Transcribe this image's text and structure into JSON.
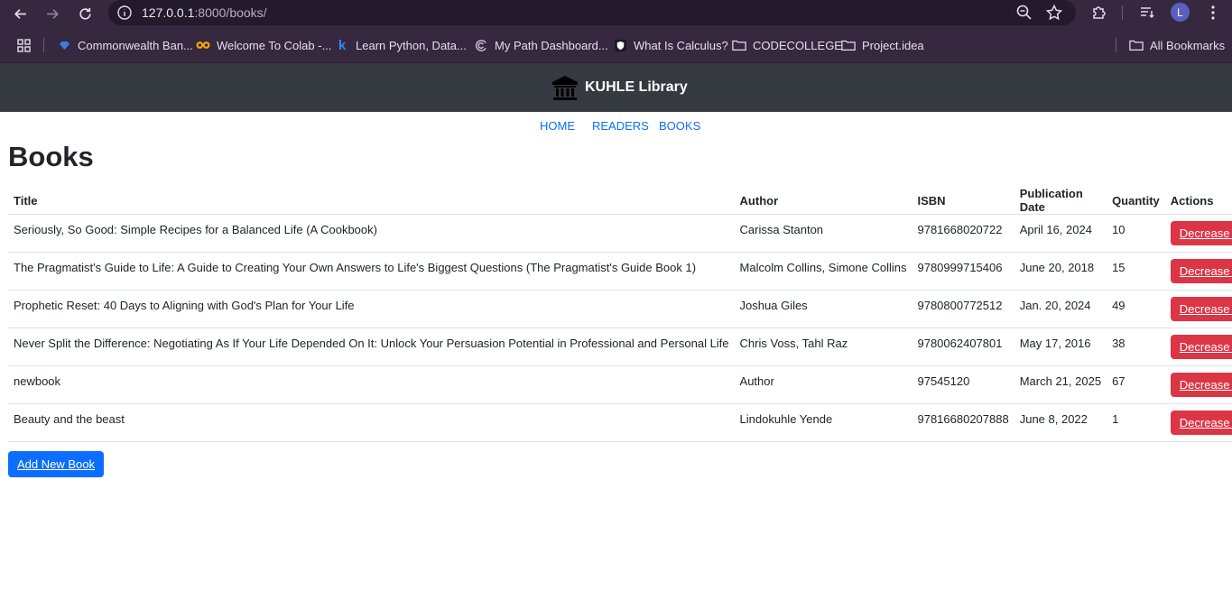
{
  "browser": {
    "url_host": "127.0.0.1",
    "url_rest": ":8000/books/",
    "profile_initial": "L",
    "bookmarks": [
      {
        "label": "Commonwealth Ban...",
        "icon": "diamond-icon",
        "color": "#3b7ae0"
      },
      {
        "label": "Welcome To Colab -...",
        "icon": "colab-icon",
        "color": "#f9ab00"
      },
      {
        "label": "Learn Python, Data...",
        "icon": "k-icon",
        "color": "#2d8cf0"
      },
      {
        "label": "My Path Dashboard...",
        "icon": "swirl-icon",
        "color": "#cfc7d8"
      },
      {
        "label": "What Is Calculus?",
        "icon": "shield-icon",
        "color": "#ffffff"
      },
      {
        "label": "CODECOLLEGE",
        "icon": "folder-icon",
        "color": "#e6dfec"
      },
      {
        "label": "Project.idea",
        "icon": "folder-icon",
        "color": "#e6dfec"
      }
    ],
    "all_bookmarks": "All Bookmarks"
  },
  "site": {
    "brand": "KUHLE Library",
    "nav": [
      "HOME",
      "READERS",
      "BOOKS"
    ]
  },
  "page": {
    "title": "Books",
    "columns": [
      "Title",
      "Author",
      "ISBN",
      "Publication Date",
      "Quantity",
      "Actions"
    ],
    "rows": [
      {
        "title": "Seriously, So Good: Simple Recipes for a Balanced Life (A Cookbook)",
        "author": "Carissa Stanton",
        "isbn": "9781668020722",
        "date": "April 16, 2024",
        "qty": "10",
        "action": "Decrease Quantity"
      },
      {
        "title": "The Pragmatist's Guide to Life: A Guide to Creating Your Own Answers to Life's Biggest Questions (The Pragmatist's Guide Book 1)",
        "author": "Malcolm Collins, Simone Collins",
        "isbn": "9780999715406",
        "date": "June 20, 2018",
        "qty": "15",
        "action": "Decrease Quantity"
      },
      {
        "title": "Prophetic Reset: 40 Days to Aligning with God's Plan for Your Life",
        "author": "Joshua Giles",
        "isbn": "9780800772512",
        "date": "Jan. 20, 2024",
        "qty": "49",
        "action": "Decrease Quantity"
      },
      {
        "title": "Never Split the Difference: Negotiating As If Your Life Depended On It: Unlock Your Persuasion Potential in Professional and Personal Life",
        "author": "Chris Voss, Tahl Raz",
        "isbn": "9780062407801",
        "date": "May 17, 2016",
        "qty": "38",
        "action": "Decrease Quantity"
      },
      {
        "title": "newbook",
        "author": "Author",
        "isbn": "97545120",
        "date": "March 21, 2025",
        "qty": "67",
        "action": "Decrease Quantity"
      },
      {
        "title": "Beauty and the beast",
        "author": "Lindokuhle Yende",
        "isbn": "97816680207888",
        "date": "June 8, 2022",
        "qty": "1",
        "action": "Decrease Quantity"
      }
    ],
    "add_button": "Add New Book"
  },
  "colors": {
    "chrome_bg": "#35283f",
    "header_bg": "#343a40",
    "link": "#0d6efd",
    "danger": "#dc3545",
    "primary": "#0d6efd"
  }
}
